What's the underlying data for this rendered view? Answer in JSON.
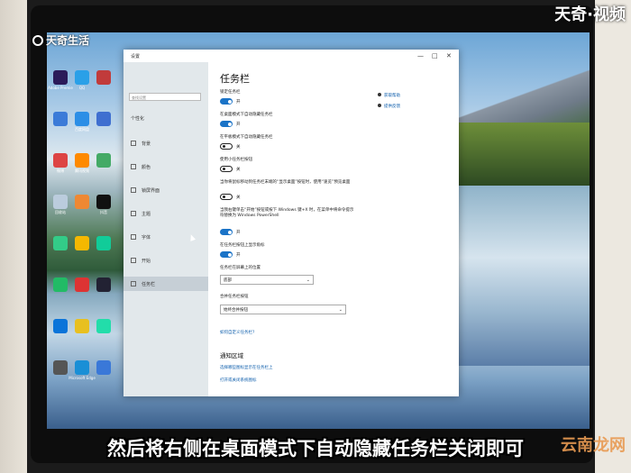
{
  "overlay": {
    "top_left_logo": "天奇生活",
    "top_right_logo": "天奇·视频",
    "caption": "然后将右侧在桌面模式下自动隐藏任务栏关闭即可",
    "watermark": "云南龙网"
  },
  "desktop_icons": [
    {
      "label": "Adobe Premie",
      "color": "#2b1b5a"
    },
    {
      "label": "QQ",
      "color": "#2aa0e8"
    },
    {
      "label": "",
      "color": "#c13b3b"
    },
    {
      "label": "",
      "color": "#3b7bd8"
    },
    {
      "label": "百度网盘",
      "color": "#2b8ee6"
    },
    {
      "label": "",
      "color": "#3f6fd0"
    },
    {
      "label": "微博",
      "color": "#d44"
    },
    {
      "label": "腾讯视频",
      "color": "#ff8a00"
    },
    {
      "label": "",
      "color": "#4a6"
    },
    {
      "label": "回收站",
      "color": "#bcd"
    },
    {
      "label": "",
      "color": "#e83"
    },
    {
      "label": "抖音",
      "color": "#111"
    },
    {
      "label": "",
      "color": "#3c8"
    },
    {
      "label": "",
      "color": "#f5b800"
    },
    {
      "label": "",
      "color": "#1c9"
    },
    {
      "label": "",
      "color": "#2b6"
    },
    {
      "label": "",
      "color": "#d33"
    },
    {
      "label": "",
      "color": "#223"
    },
    {
      "label": "",
      "color": "#0a74d9"
    },
    {
      "label": "",
      "color": "#e8c020"
    },
    {
      "label": "",
      "color": "#2da"
    },
    {
      "label": "",
      "color": "#555"
    },
    {
      "label": "Microsoft Edge",
      "color": "#1a8fd6"
    },
    {
      "label": "",
      "color": "#3a78d8"
    }
  ],
  "window": {
    "title": "设置",
    "controls": {
      "minimize": "—",
      "maximize": "□",
      "close": "✕"
    },
    "sidebar": {
      "search_placeholder": "查找设置",
      "section": "个性化",
      "items": [
        {
          "label": "背景",
          "icon": "picture-icon"
        },
        {
          "label": "颜色",
          "icon": "palette-icon"
        },
        {
          "label": "锁屏界面",
          "icon": "lock-screen-icon"
        },
        {
          "label": "主题",
          "icon": "theme-icon"
        },
        {
          "label": "字体",
          "icon": "font-icon"
        },
        {
          "label": "开始",
          "icon": "start-icon"
        },
        {
          "label": "任务栏",
          "icon": "taskbar-icon"
        }
      ]
    },
    "main": {
      "title": "任务栏",
      "right_links": [
        "获取帮助",
        "提供反馈"
      ],
      "toggles": [
        {
          "label": "锁定任务栏",
          "state": "开",
          "on": true
        },
        {
          "label": "在桌面模式下自动隐藏任务栏",
          "state": "开",
          "on": true
        },
        {
          "label": "在平板模式下自动隐藏任务栏",
          "state": "关",
          "on": false
        },
        {
          "label": "使用小任务栏按钮",
          "state": "关",
          "on": false
        },
        {
          "label": "当你将鼠标移动到任务栏末端的“显示桌面”按钮时，使用“速览”预览桌面",
          "state": "关",
          "on": false
        },
        {
          "label": "当我右键单击“开始”按钮或按下 Windows 键+X 时，在菜单中将命令提示符替换为 Windows PowerShell",
          "state": "开",
          "on": true
        },
        {
          "label": "在任务栏按钮上显示角标",
          "state": "开",
          "on": true
        }
      ],
      "position_label": "任务栏在屏幕上的位置",
      "position_value": "底部",
      "combine_label": "合并任务栏按钮",
      "combine_value": "始终合并按钮",
      "customize_link": "如何自定义任务栏?",
      "notify_section": "通知区域",
      "notify_link1": "选择哪些图标显示在任务栏上",
      "notify_link2": "打开或关闭系统图标"
    }
  }
}
